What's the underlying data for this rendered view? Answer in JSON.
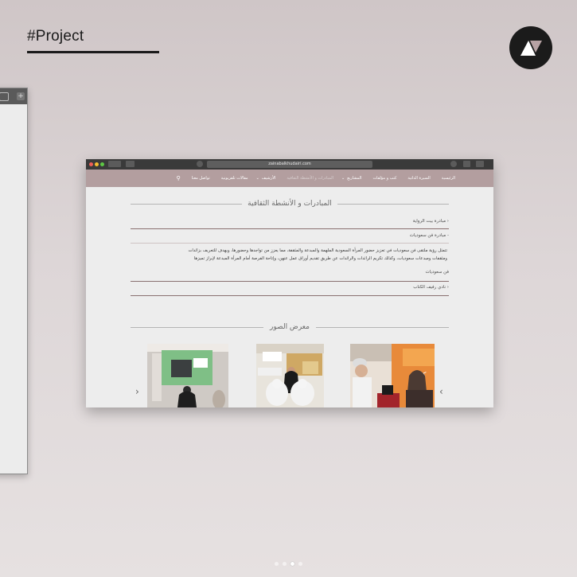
{
  "page": {
    "title": "#Project"
  },
  "browser": {
    "url": "zainabalkhudairi.com",
    "nav_items": [
      {
        "label": "الرئيسية",
        "dim": false
      },
      {
        "label": "السيرة الذاتية",
        "dim": false
      },
      {
        "label": "كتب و مؤلفات",
        "dim": false
      },
      {
        "label": "المشاريع",
        "dim": false,
        "chevron": true
      },
      {
        "label": "المبادرات و الأنشطة الثقافية",
        "dim": true
      },
      {
        "label": "الأرشيف",
        "dim": false,
        "chevron": true
      },
      {
        "label": "مقالات تلفزيونية",
        "dim": false
      },
      {
        "label": "تواصل معنا",
        "dim": false
      }
    ],
    "initiatives": {
      "title": "المبادرات و الأنشطة الثقافية",
      "items": [
        {
          "label": "مبادرة بيت الرواية",
          "expanded": false
        },
        {
          "label": "مبادرة فن سعوديات",
          "expanded": true
        },
        {
          "label": "فن سعوديات",
          "expanded": false
        },
        {
          "label": "نادي رفيف الكتاب",
          "expanded": false
        }
      ],
      "paragraph_line1": "تتمثل رؤية ملتقى فن سعوديات في تعزيز حضور المرأة السعودية الملهمة والمبدعة والمثقفة، مما يعزز من تواجدها وحضورها، ويهدف للتعريف بزائدات",
      "paragraph_line2": "ومثقفات ومبدعات سعوديات، وكذلك تكريم الرائدات والرائدات عن طريق تقديم أوراق عمل عنهن، وإتاحة الفرصة أمام المرأة المبدعة لإبراز تميزها"
    },
    "gallery": {
      "title": "معرض الصور",
      "prev_icon": "‹",
      "next_icon": "›"
    }
  },
  "carousel": {
    "count": 4,
    "active_index": 2
  },
  "colors": {
    "nav_bg": "#b39e9f",
    "accent_rule": "#8a7070"
  }
}
